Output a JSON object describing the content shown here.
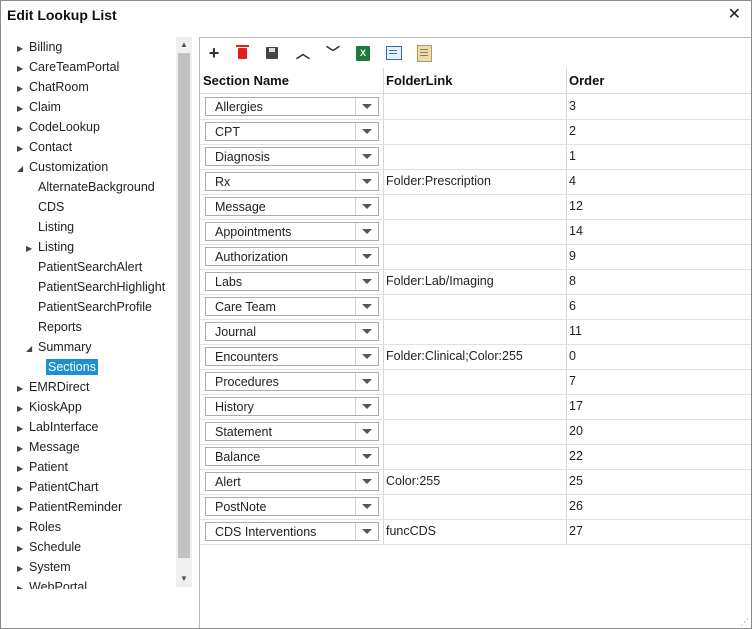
{
  "window": {
    "title": "Edit Lookup List",
    "close_glyph": "✕"
  },
  "tree": {
    "items": [
      {
        "label": "Billing",
        "arrow": "collapsed",
        "indent": 0
      },
      {
        "label": "CareTeamPortal",
        "arrow": "collapsed",
        "indent": 0
      },
      {
        "label": "ChatRoom",
        "arrow": "collapsed",
        "indent": 0
      },
      {
        "label": "Claim",
        "arrow": "collapsed",
        "indent": 0
      },
      {
        "label": "CodeLookup",
        "arrow": "collapsed",
        "indent": 0
      },
      {
        "label": "Contact",
        "arrow": "collapsed",
        "indent": 0
      },
      {
        "label": "Customization",
        "arrow": "expanded",
        "indent": 0
      },
      {
        "label": "AlternateBackground",
        "arrow": "none",
        "indent": 1
      },
      {
        "label": "CDS",
        "arrow": "none",
        "indent": 1
      },
      {
        "label": "Listing",
        "arrow": "none",
        "indent": 1
      },
      {
        "label": "Listing",
        "arrow": "collapsed",
        "indent": 1
      },
      {
        "label": "PatientSearchAlert",
        "arrow": "none",
        "indent": 1
      },
      {
        "label": "PatientSearchHighlight",
        "arrow": "none",
        "indent": 1
      },
      {
        "label": "PatientSearchProfile",
        "arrow": "none",
        "indent": 1
      },
      {
        "label": "Reports",
        "arrow": "none",
        "indent": 1
      },
      {
        "label": "Summary",
        "arrow": "expanded",
        "indent": 1
      },
      {
        "label": "Sections",
        "arrow": "none",
        "indent": 2,
        "selected": true
      },
      {
        "label": "EMRDirect",
        "arrow": "collapsed",
        "indent": 0
      },
      {
        "label": "KioskApp",
        "arrow": "collapsed",
        "indent": 0
      },
      {
        "label": "LabInterface",
        "arrow": "collapsed",
        "indent": 0
      },
      {
        "label": "Message",
        "arrow": "collapsed",
        "indent": 0
      },
      {
        "label": "Patient",
        "arrow": "collapsed",
        "indent": 0
      },
      {
        "label": "PatientChart",
        "arrow": "collapsed",
        "indent": 0
      },
      {
        "label": "PatientReminder",
        "arrow": "collapsed",
        "indent": 0
      },
      {
        "label": "Roles",
        "arrow": "collapsed",
        "indent": 0
      },
      {
        "label": "Schedule",
        "arrow": "collapsed",
        "indent": 0
      },
      {
        "label": "System",
        "arrow": "collapsed",
        "indent": 0
      },
      {
        "label": "WebPortal",
        "arrow": "collapsed",
        "indent": 0
      }
    ]
  },
  "toolbar": {
    "icons": [
      "add-icon",
      "delete-icon",
      "save-icon",
      "move-up-icon",
      "move-down-icon",
      "excel-icon",
      "export-icon",
      "notes-icon"
    ],
    "excel_glyph": "X"
  },
  "grid": {
    "headers": {
      "section_name": "Section Name",
      "folder_link": "FolderLink",
      "order": "Order"
    },
    "rows": [
      {
        "section": "Allergies",
        "folder": "",
        "order": "3"
      },
      {
        "section": "CPT",
        "folder": "",
        "order": "2"
      },
      {
        "section": "Diagnosis",
        "folder": "",
        "order": "1"
      },
      {
        "section": "Rx",
        "folder": "Folder:Prescription",
        "order": "4"
      },
      {
        "section": "Message",
        "folder": "",
        "order": "12"
      },
      {
        "section": "Appointments",
        "folder": "",
        "order": "14"
      },
      {
        "section": "Authorization",
        "folder": "",
        "order": "9"
      },
      {
        "section": "Labs",
        "folder": "Folder:Lab/Imaging",
        "order": "8"
      },
      {
        "section": "Care Team",
        "folder": "",
        "order": "6"
      },
      {
        "section": "Journal",
        "folder": "",
        "order": "11"
      },
      {
        "section": "Encounters",
        "folder": "Folder:Clinical;Color:255",
        "order": "0"
      },
      {
        "section": "Procedures",
        "folder": "",
        "order": "7"
      },
      {
        "section": "History",
        "folder": "",
        "order": "17"
      },
      {
        "section": "Statement",
        "folder": "",
        "order": "20"
      },
      {
        "section": "Balance",
        "folder": "",
        "order": "22"
      },
      {
        "section": "Alert",
        "folder": "Color:255",
        "order": "25"
      },
      {
        "section": "PostNote",
        "folder": "",
        "order": "26"
      },
      {
        "section": "CDS Interventions",
        "folder": "funcCDS",
        "order": "27"
      }
    ]
  },
  "colors": {
    "selection": "#1e8fd6",
    "delete": "#e02020",
    "excel": "#1f7a3a"
  }
}
